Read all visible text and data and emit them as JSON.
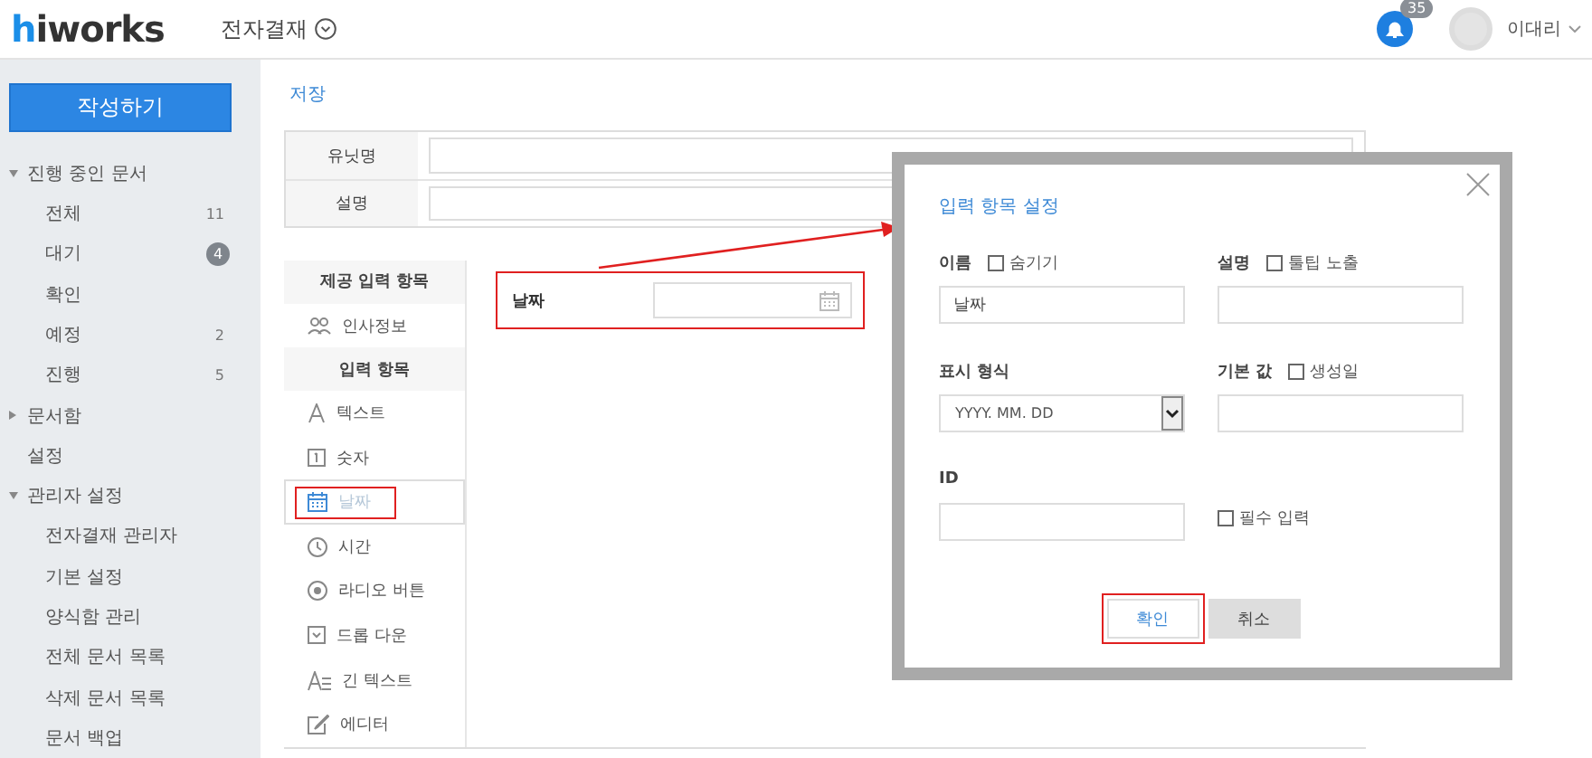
{
  "header": {
    "logo_accent": "h",
    "logo_rest": "iworks",
    "app_menu": "전자결재",
    "notification_count": "35",
    "user_name": "이대리"
  },
  "sidebar": {
    "compose_button": "작성하기",
    "sections": [
      {
        "kind": "group",
        "label": "진행 중인 문서",
        "expanded": true,
        "children": [
          {
            "label": "전체",
            "count": "11",
            "kind": "plain"
          },
          {
            "label": "대기",
            "count": "4",
            "kind": "badge"
          },
          {
            "label": "확인"
          },
          {
            "label": "예정",
            "count": "2",
            "kind": "plain"
          },
          {
            "label": "진행",
            "count": "5",
            "kind": "plain"
          }
        ]
      },
      {
        "kind": "group",
        "label": "문서함",
        "expanded": false
      },
      {
        "kind": "link",
        "label": "설정"
      },
      {
        "kind": "group",
        "label": "관리자 설정",
        "expanded": true,
        "children": [
          {
            "label": "전자결재 관리자"
          },
          {
            "label": "기본 설정"
          },
          {
            "label": "양식함 관리"
          },
          {
            "label": "전체 문서 목록"
          },
          {
            "label": "삭제 문서 목록"
          },
          {
            "label": "문서 백업"
          }
        ]
      }
    ]
  },
  "main": {
    "save_link": "저장",
    "form_rows": [
      {
        "label": "유닛명"
      },
      {
        "label": "설명"
      }
    ],
    "palette": [
      {
        "kind": "header",
        "label": "제공 입력 항목"
      },
      {
        "kind": "item",
        "label": "인사정보",
        "selected": false,
        "highlighted": false
      },
      {
        "kind": "header",
        "label": "입력 항목"
      },
      {
        "kind": "item",
        "label": "텍스트",
        "selected": false,
        "highlighted": false
      },
      {
        "kind": "item",
        "label": "숫자",
        "selected": false,
        "highlighted": false
      },
      {
        "kind": "item",
        "label": "날짜",
        "selected": true,
        "highlighted": true
      },
      {
        "kind": "item",
        "label": "시간",
        "selected": false,
        "highlighted": false
      },
      {
        "kind": "item",
        "label": "라디오 버튼",
        "selected": false,
        "highlighted": false
      },
      {
        "kind": "item",
        "label": "드롭 다운",
        "selected": false,
        "highlighted": false
      },
      {
        "kind": "item",
        "label": "긴 텍스트",
        "selected": false,
        "highlighted": false
      },
      {
        "kind": "item",
        "label": "에디터",
        "selected": false,
        "highlighted": false
      }
    ],
    "preview_field": {
      "label": "날짜",
      "highlighted": true
    }
  },
  "dialog": {
    "title": "입력 항목 설정",
    "name": {
      "label": "이름",
      "option": "숨기기",
      "checked": false,
      "value": "날짜"
    },
    "description": {
      "label": "설명",
      "option": "툴팁 노출",
      "checked": false
    },
    "format": {
      "label": "표시 형식",
      "value": "YYYY. MM. DD"
    },
    "default": {
      "label": "기본 값",
      "option": "생성일",
      "checked": false
    },
    "id": {
      "label": "ID"
    },
    "required": {
      "option": "필수 입력",
      "checked": false
    },
    "buttons": [
      {
        "label": "확인",
        "kind": "primary",
        "highlighted": true
      },
      {
        "label": "취소",
        "kind": "secondary",
        "highlighted": false
      }
    ]
  }
}
